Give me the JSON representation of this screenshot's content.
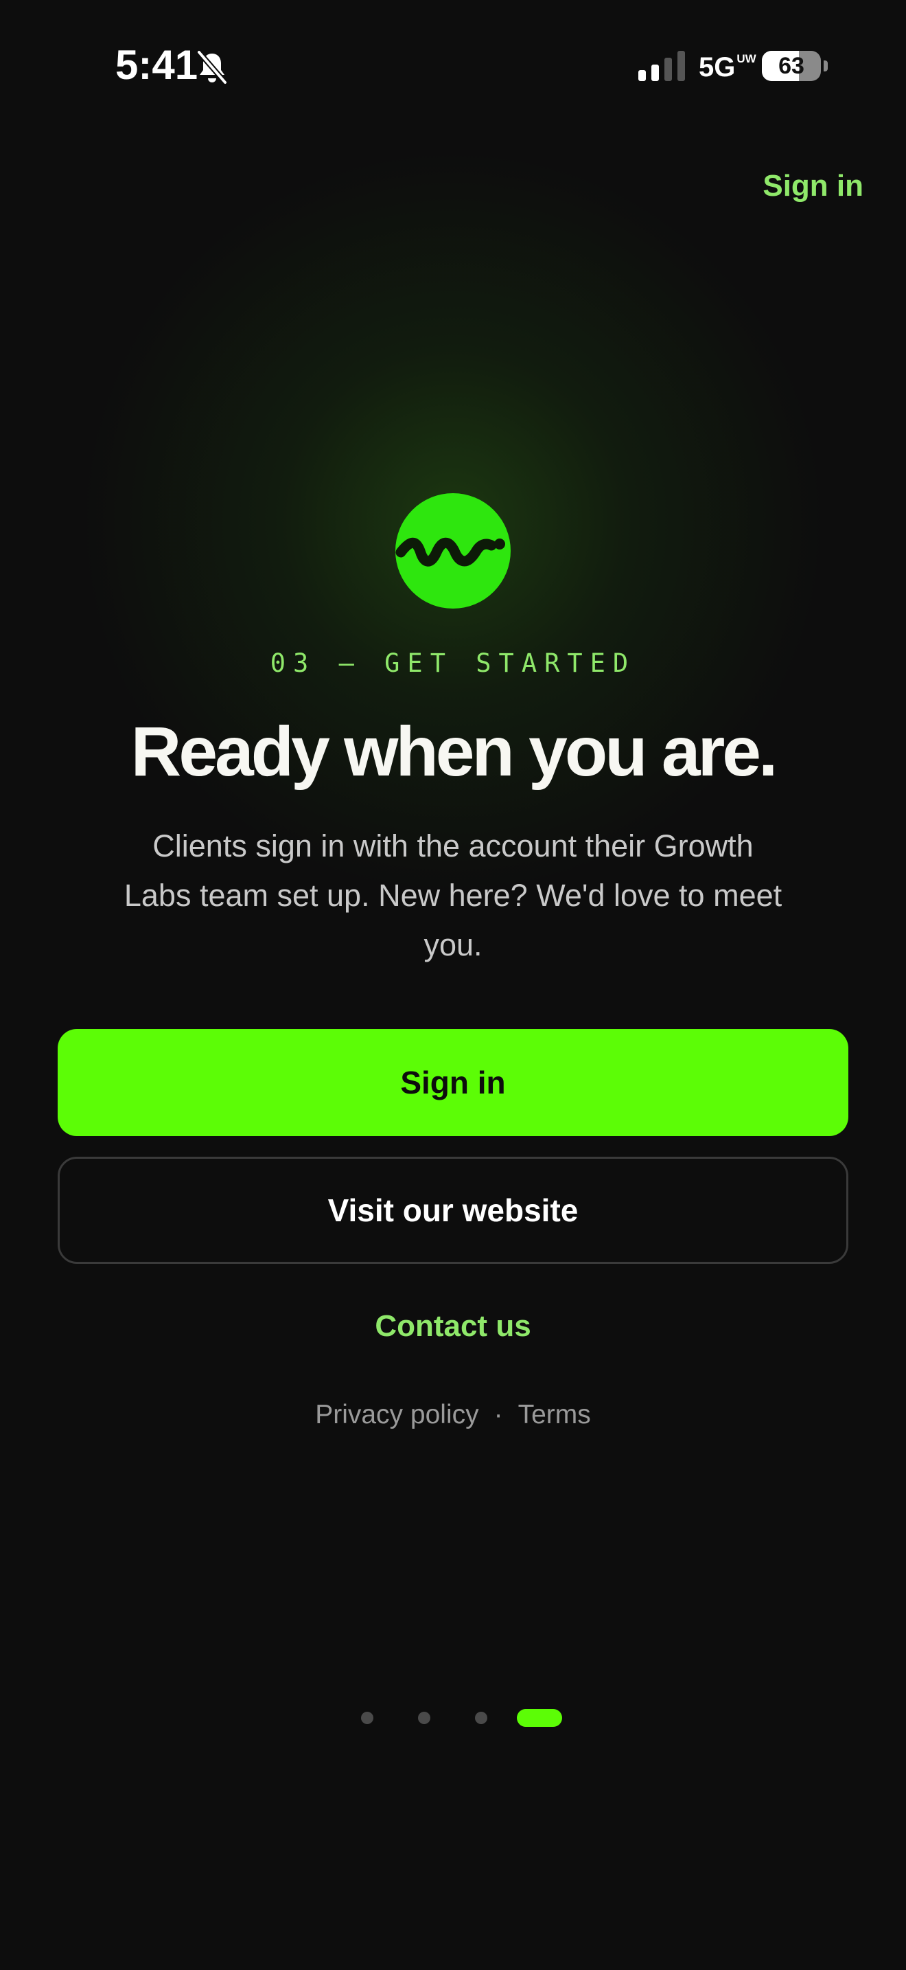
{
  "status_bar": {
    "time": "5:41",
    "network": "5G",
    "network_suffix": "UW",
    "battery": "63",
    "battery_level": 0.63
  },
  "header": {
    "sign_in_link": "Sign in"
  },
  "hero": {
    "step_label": "03 — GET STARTED",
    "title": "Ready when you are.",
    "description": "Clients sign in with the account their Growth Labs team set up. New here? We'd love to meet you."
  },
  "actions": {
    "primary_label": "Sign in",
    "secondary_label": "Visit our website",
    "contact_label": "Contact us"
  },
  "footer": {
    "privacy_label": "Privacy policy",
    "separator": "·",
    "terms_label": "Terms"
  },
  "pager": {
    "total": 4,
    "current": 4
  },
  "colors": {
    "accent": "#5cfd06",
    "accent_text": "#8fe86a",
    "background": "#0d0d0d"
  },
  "icons": {
    "silent": "bell-slash-icon",
    "signal": "cellular-signal-icon",
    "battery": "battery-icon",
    "logo": "wave-logo-icon"
  }
}
